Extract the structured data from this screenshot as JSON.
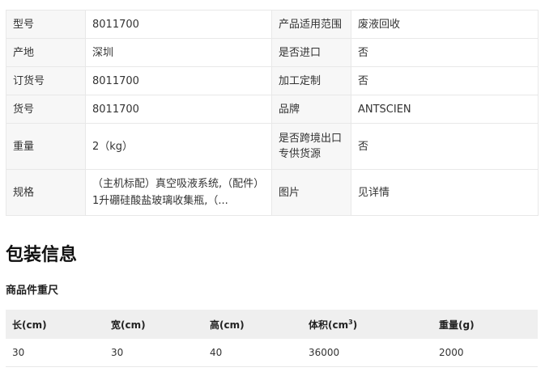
{
  "specs": {
    "rows": [
      {
        "k1": "型号",
        "v1": "8011700",
        "k2": "产品适用范围",
        "v2": "废液回收"
      },
      {
        "k1": "产地",
        "v1": "深圳",
        "k2": "是否进口",
        "v2": "否"
      },
      {
        "k1": "订货号",
        "v1": "8011700",
        "k2": "加工定制",
        "v2": "否"
      },
      {
        "k1": "货号",
        "v1": "8011700",
        "k2": "品牌",
        "v2": "ANTSCIEN"
      },
      {
        "k1": "重量",
        "v1": "2（kg）",
        "k2": "是否跨境出口专供货源",
        "v2": "否"
      },
      {
        "k1": "规格",
        "v1": "（主机标配）真空吸液系统,（配件）1升硼硅酸盐玻璃收集瓶,（...",
        "k2": "图片",
        "v2": "见详情"
      }
    ]
  },
  "packaging": {
    "section_title": "包装信息",
    "subtitle": "商品件重尺",
    "headers": {
      "length": "长(cm)",
      "width": "宽(cm)",
      "height": "高(cm)",
      "volume_prefix": "体积(cm",
      "volume_sup": "3",
      "volume_suffix": ")",
      "weight": "重量(g)"
    },
    "row": {
      "length": "30",
      "width": "30",
      "height": "40",
      "volume": "36000",
      "weight": "2000"
    }
  }
}
